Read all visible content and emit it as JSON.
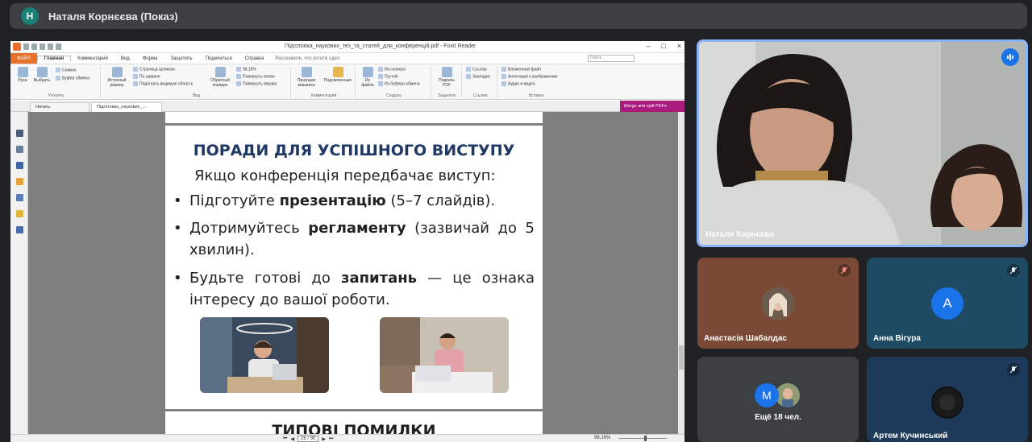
{
  "meeting": {
    "presenter_initial": "Н",
    "presenter_label": "Наталя Корнєєва (Показ)"
  },
  "reader": {
    "window_title": "Підготовка_наукових_тез_та_статей_для_конференцій.pdf - Foxit Reader",
    "file_tab": "ФАЙЛ",
    "menu": [
      "Главная",
      "Комментарий",
      "Вид",
      "Форма",
      "Защитить",
      "Поделиться",
      "Справка"
    ],
    "tell_me": "Расскажите, что хотите сдел",
    "search_placeholder": "Поиск",
    "ribbon": {
      "hand": "Рука",
      "select": "Выбрать",
      "snapshot": "Снимок",
      "clipboard": "Буфер обмена",
      "tools_label": "Утилиты",
      "actual_size": "Истинный размер",
      "fit_page": "Страница целиком",
      "fit_width": "По ширине",
      "fit_visible": "Подогнать видимую область",
      "reflow": "Обратный порядок",
      "zoom_value": "98,16%",
      "rotate_left": "Повернуть влево",
      "rotate_right": "Повернуть вправо",
      "view_label": "Вид",
      "typewriter": "Пишущая машинка",
      "highlight": "Подсвеченные",
      "comment_label": "Комментарий",
      "from_file": "Из файла",
      "from_scanner": "Из сканера",
      "blank": "Пустой",
      "from_clipboard": "Из буфера обмена",
      "create_label": "Создать",
      "sign_pdf": "Подпись PDF",
      "protect_label": "Защитить",
      "link": "Ссылка",
      "bookmark": "Закладка",
      "links_label": "Ссылки",
      "attach_file": "Вложенный файл",
      "image_annot": "Аннотация к изображению",
      "audio_video": "Аудио и видео",
      "insert_label": "Вставка"
    },
    "tabs": [
      "Начать",
      "Підготовка_наукових_..."
    ],
    "merge_button": "Merge and split PDFs",
    "status": {
      "page_current": "25",
      "page_total": "/ 30",
      "zoom": "98,16%"
    }
  },
  "slide": {
    "title": "ПОРАДИ ДЛЯ УСПІШНОГО ВИСТУПУ",
    "intro": "Якщо конференція передбачає виступ:",
    "b1_pre": "Підготуйте ",
    "b1_bold": "презентацію",
    "b1_post": " (5–7 слайдів).",
    "b2_pre": "Дотримуйтесь ",
    "b2_bold": "регламенту",
    "b2_post": " (зазвичай до 5 хвилин).",
    "b3_pre": "Будьте готові до ",
    "b3_bold": "запитань",
    "b3_post": " — це ознака інтересу до вашої роботи.",
    "bullet_char": "•",
    "next_title": "ТИПОВІ ПОМИЛКИ"
  },
  "participants": {
    "main": "Наталя Корнєєва",
    "p1": "Анастасія Шабалдас",
    "p2_initial": "А",
    "p2": "Анна Вігура",
    "more_initial": "М",
    "more": "Ещё 18 чел.",
    "p4": "Артем Кучинський"
  },
  "colors": {
    "foxit_orange": "#e8712a",
    "merge_purple": "#a91c7e",
    "meet_bg": "#202124",
    "active_speaker_border": "#8ab4f8"
  }
}
